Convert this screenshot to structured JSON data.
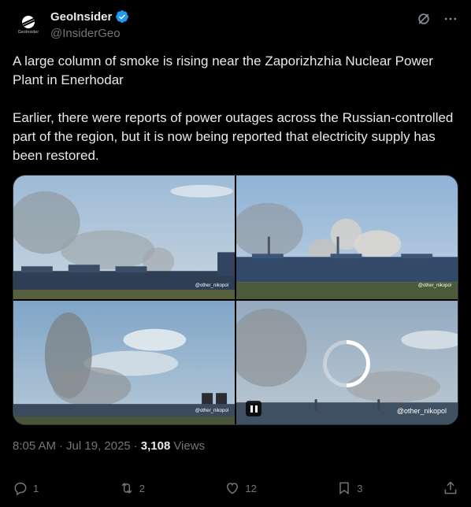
{
  "author": {
    "display_name": "GeoInsider",
    "handle": "@InsiderGeo",
    "avatar_caption": "GeoInsider",
    "verified": true
  },
  "tweet": {
    "paragraphs": [
      "A large column of smoke is rising near the Zaporizhzhia Nuclear Power Plant in Enerhodar",
      "Earlier, there were reports of power outages across the Russian-controlled part of the region, but it is now being reported that electricity supply has been restored."
    ]
  },
  "media": {
    "tiles": [
      {
        "watermark": "@other_nikopol"
      },
      {
        "watermark": "@other_nikopol"
      },
      {
        "watermark": "@other_nikopol"
      },
      {
        "watermark": "@other_nikopol"
      }
    ]
  },
  "meta": {
    "time": "8:05 AM",
    "separator": "·",
    "date": "Jul 19, 2025",
    "views_count": "3,108",
    "views_label": "Views"
  },
  "actions": {
    "replies": "1",
    "reposts": "2",
    "likes": "12",
    "bookmarks": "3"
  },
  "colors": {
    "background": "#000000",
    "text": "#e7e9ea",
    "muted": "#71767b",
    "verified": "#1d9bf0"
  }
}
